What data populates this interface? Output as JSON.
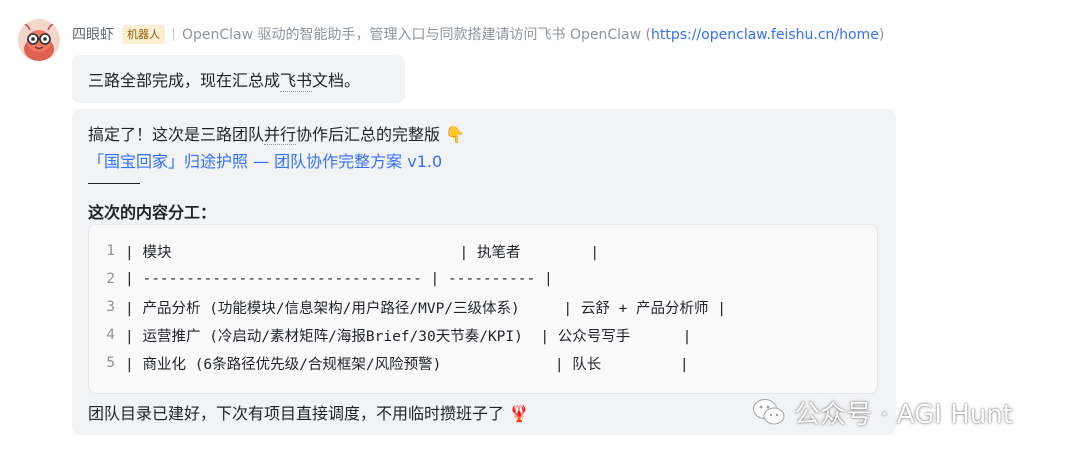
{
  "message": {
    "sender_name": "四眼虾",
    "bot_badge": "机器人",
    "bot_description": "OpenClaw 驱动的智能助手，管理入口与同款搭建请访问飞书 OpenClaw (",
    "bot_link": "https://openclaw.feishu.cn/home",
    "bot_description_end": ")"
  },
  "bubble1": {
    "text_before": "三路全部完成，现在汇总成",
    "text_underlined": "飞书",
    "text_after": "文档。"
  },
  "bubble2": {
    "intro_before": "搞定了！这次是三路团队",
    "intro_underlined": "并行",
    "intro_after": "协作后汇总的完整版 👇",
    "doc_link": "「国宝回家」归途护照 — 团队协作完整方案 v1.0",
    "section_title": "这次的内容分工：",
    "code_lines": [
      {
        "num": "1",
        "text": "| 模块                                 | 执笔者        |"
      },
      {
        "num": "2",
        "text": "| -------------------------------- | ---------- |"
      },
      {
        "num": "3",
        "text": "| 产品分析 (功能模块/信息架构/用户路径/MVP/三级体系)     | 云舒 + 产品分析师 |"
      },
      {
        "num": "4",
        "text": "| 运营推广 (冷启动/素材矩阵/海报Brief/30天节奏/KPI)  | 公众号写手      |"
      },
      {
        "num": "5",
        "text": "| 商业化 (6条路径优先级/合规框架/风险预警)             | 队长         |"
      }
    ],
    "footer": "团队目录已建好，下次有项目直接调度，不用临时攒班子了 🦞"
  },
  "watermark": {
    "text": "公众号 · AGI Hunt"
  },
  "colors": {
    "bubble_bg": "#f2f3f5",
    "link": "#3370ff",
    "badge_bg": "#faefd2",
    "badge_text": "#8f5b00"
  }
}
